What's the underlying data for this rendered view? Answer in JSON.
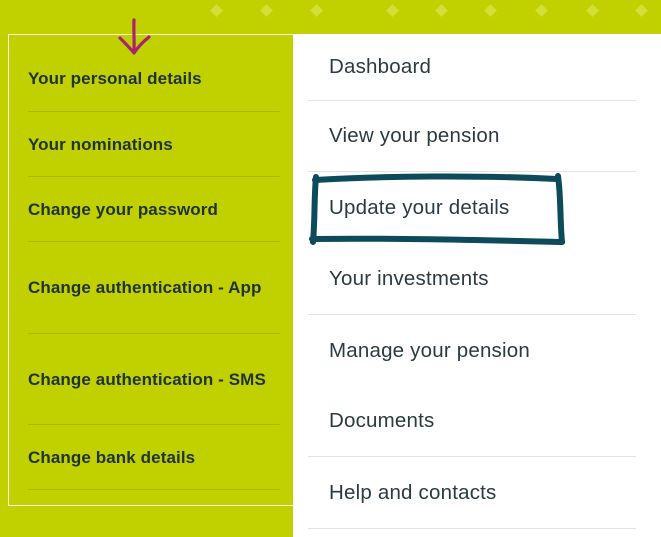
{
  "colors": {
    "brand_lime": "#c1d100",
    "text_dark": "#20323a",
    "annotation_box": "#0c4a5c",
    "annotation_arrow": "#a8246e"
  },
  "submenu": {
    "items": [
      {
        "label": "Your personal details"
      },
      {
        "label": "Your nominations"
      },
      {
        "label": "Change your password"
      },
      {
        "label": "Change authentication - App"
      },
      {
        "label": "Change authentication - SMS"
      },
      {
        "label": "Change bank details"
      }
    ]
  },
  "main_nav": {
    "items": [
      {
        "label": "Dashboard"
      },
      {
        "label": "View your pension"
      },
      {
        "label": "Update your details"
      },
      {
        "label": "Your investments"
      },
      {
        "label": "Manage your pension"
      },
      {
        "label": "Documents"
      },
      {
        "label": "Help and contacts"
      }
    ]
  },
  "annotations": {
    "arrow_icon": "down-arrow-icon",
    "highlight_target": "Update your details"
  }
}
